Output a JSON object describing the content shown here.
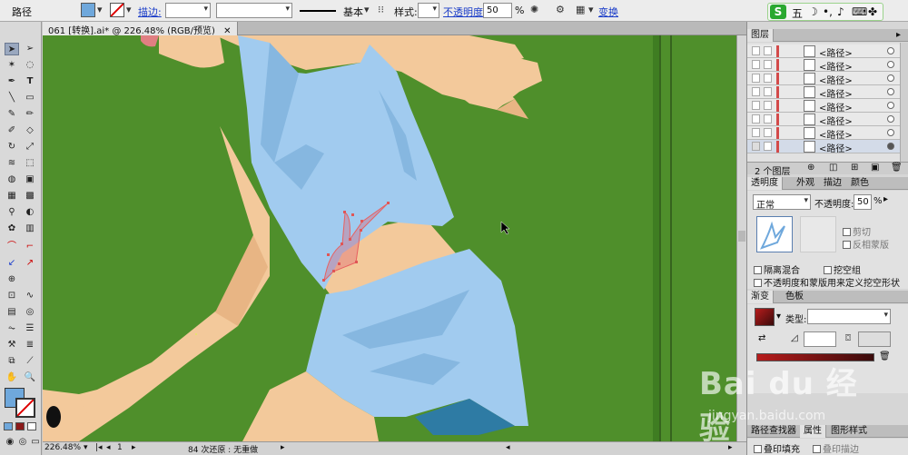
{
  "control_bar": {
    "object_type": "路径",
    "stroke_label": "描边:",
    "brush_label": "基本",
    "style_label": "样式:",
    "opacity_label": "不透明度:",
    "opacity_value": "50",
    "percent": "%",
    "transform_link": "变换",
    "fill_color": "#6fa8dc"
  },
  "document": {
    "tab_title": "061 [转换].ai* @ 226.48% (RGB/预览)",
    "zoom": "226.48%",
    "page": "1",
    "status_text": "84 次还原 : 无重做"
  },
  "layers_panel": {
    "title": "图层",
    "rows": [
      {
        "name": "<路径>"
      },
      {
        "name": "<路径>"
      },
      {
        "name": "<路径>"
      },
      {
        "name": "<路径>"
      },
      {
        "name": "<路径>"
      },
      {
        "name": "<路径>"
      },
      {
        "name": "<路径>"
      },
      {
        "name": "<路径>"
      }
    ],
    "footer": "2 个图层"
  },
  "transparency_panel": {
    "tabs": [
      "透明度",
      "外观",
      "描边",
      "颜色"
    ],
    "blend_mode": "正常",
    "opacity_label": "不透明度:",
    "opacity_value": "50",
    "percent": "%",
    "clip": "剪切",
    "invert_mask": "反相蒙版",
    "isolate_blending": "隔离混合",
    "knockout_group": "挖空组",
    "opacity_mask_define": "不透明度和蒙版用来定义挖空形状"
  },
  "gradient_panel": {
    "tabs": [
      "渐变",
      "色板"
    ],
    "type_label": "类型:",
    "start_color": "#b71c1c",
    "end_color": "#3a0b0b"
  },
  "bottom_panel": {
    "tabs": [
      "路径查找器",
      "属性",
      "图形样式"
    ],
    "overprint_fill": "叠印填充",
    "overprint_stroke": "叠印描边"
  },
  "ime": {
    "logo": "S",
    "mode": "五"
  },
  "watermark": {
    "brand": "Bai du 经验",
    "url": "jingyan.baidu.com"
  }
}
